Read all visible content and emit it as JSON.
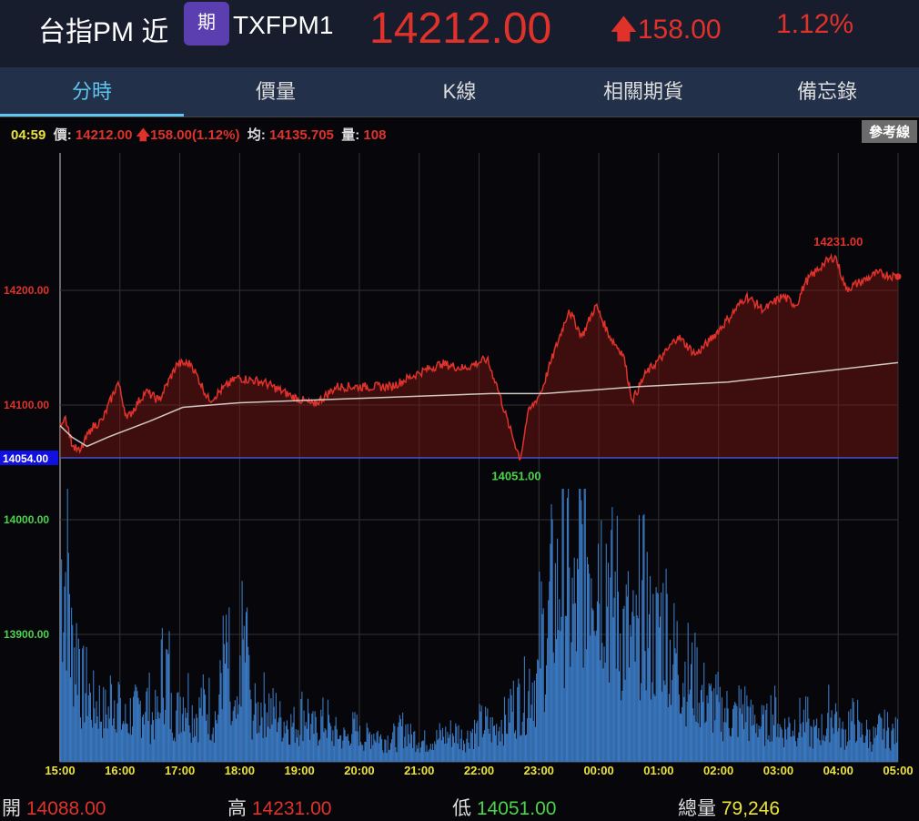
{
  "header": {
    "name": "台指PM 近",
    "badge": "期",
    "code": "TXFPM1",
    "price": "14212.00",
    "change": "158.00",
    "change_pct": "1.12%"
  },
  "tabs": [
    "分時",
    "價量",
    "K線",
    "相關期貨",
    "備忘錄"
  ],
  "info": {
    "time": "04:59",
    "price_label": "價:",
    "price": "14212.00",
    "change": "158.00(1.12%)",
    "avg_label": "均:",
    "avg": "14135.705",
    "vol_label": "量:",
    "vol": "108"
  },
  "ref_button": "參考線",
  "footer": {
    "open_label": "開",
    "open": "14088.00",
    "high_label": "高",
    "high": "14231.00",
    "low_label": "低",
    "low": "14051.00",
    "vol_label": "總量",
    "vol": "79,246"
  },
  "chart_data": {
    "type": "line",
    "y_ticks": [
      {
        "v": 14200,
        "label": "14200.00",
        "color": "#e0322b"
      },
      {
        "v": 14100,
        "label": "14100.00",
        "color": "#e0322b"
      },
      {
        "v": 14000,
        "label": "14000.00",
        "color": "#4cd34c"
      },
      {
        "v": 13900,
        "label": "13900.00",
        "color": "#4cd34c"
      }
    ],
    "ref_price": 14054,
    "ref_label": "14054.00",
    "high": {
      "v": 14231,
      "label": "14231.00",
      "t": 13.0
    },
    "low": {
      "v": 14051,
      "label": "14051.00",
      "t": 7.7
    },
    "x_ticks": [
      "15:00",
      "16:00",
      "17:00",
      "18:00",
      "19:00",
      "20:00",
      "21:00",
      "22:00",
      "23:00",
      "00:00",
      "01:00",
      "02:00",
      "03:00",
      "04:00",
      "05:00"
    ],
    "price_series_hours": [
      [
        0,
        14084
      ],
      [
        0.09,
        14090
      ],
      [
        0.21,
        14064
      ],
      [
        0.33,
        14059
      ],
      [
        0.52,
        14080
      ],
      [
        0.71,
        14087
      ],
      [
        0.97,
        14120
      ],
      [
        1.12,
        14088
      ],
      [
        1.43,
        14112
      ],
      [
        1.65,
        14104
      ],
      [
        1.96,
        14136
      ],
      [
        2.19,
        14136
      ],
      [
        2.49,
        14104
      ],
      [
        2.95,
        14124
      ],
      [
        3.4,
        14120
      ],
      [
        3.86,
        14108
      ],
      [
        4.24,
        14100
      ],
      [
        4.62,
        14116
      ],
      [
        5.08,
        14116
      ],
      [
        5.53,
        14116
      ],
      [
        5.99,
        14128
      ],
      [
        6.37,
        14136
      ],
      [
        6.75,
        14132
      ],
      [
        7.13,
        14140
      ],
      [
        7.28,
        14120
      ],
      [
        7.51,
        14080
      ],
      [
        7.69,
        14053
      ],
      [
        7.81,
        14092
      ],
      [
        8.04,
        14112
      ],
      [
        8.19,
        14136
      ],
      [
        8.5,
        14183
      ],
      [
        8.72,
        14160
      ],
      [
        8.95,
        14187
      ],
      [
        9.18,
        14160
      ],
      [
        9.41,
        14144
      ],
      [
        9.56,
        14104
      ],
      [
        9.79,
        14128
      ],
      [
        10.09,
        14144
      ],
      [
        10.32,
        14160
      ],
      [
        10.62,
        14144
      ],
      [
        10.85,
        14156
      ],
      [
        11.16,
        14175
      ],
      [
        11.46,
        14195
      ],
      [
        11.76,
        14183
      ],
      [
        12.07,
        14195
      ],
      [
        12.3,
        14187
      ],
      [
        12.45,
        14207
      ],
      [
        12.75,
        14223
      ],
      [
        12.95,
        14230
      ],
      [
        13.13,
        14201
      ],
      [
        13.36,
        14207
      ],
      [
        13.66,
        14215
      ],
      [
        14,
        14212
      ]
    ],
    "avg_series_hours": [
      [
        0,
        14082
      ],
      [
        0.2,
        14072
      ],
      [
        0.45,
        14064
      ],
      [
        0.8,
        14072
      ],
      [
        1.5,
        14086
      ],
      [
        2.05,
        14098
      ],
      [
        3,
        14102
      ],
      [
        5.07,
        14106
      ],
      [
        7.2,
        14110
      ],
      [
        8.1,
        14110
      ],
      [
        9.64,
        14116
      ],
      [
        11.16,
        14120
      ],
      [
        12.5,
        14128
      ],
      [
        14,
        14137
      ]
    ],
    "volume_per_10min": [
      230,
      140,
      90,
      70,
      60,
      80,
      50,
      60,
      70,
      55,
      110,
      60,
      80,
      60,
      70,
      55,
      120,
      50,
      140,
      60,
      70,
      60,
      50,
      45,
      60,
      40,
      50,
      35,
      30,
      40,
      30,
      35,
      28,
      30,
      40,
      30,
      25,
      28,
      32,
      35,
      30,
      38,
      45,
      40,
      50,
      70,
      80,
      100,
      150,
      200,
      230,
      180,
      260,
      270,
      240,
      200,
      160,
      140,
      190,
      150,
      170,
      130,
      110,
      100,
      80,
      70,
      60,
      55,
      65,
      50,
      45,
      60,
      40,
      45,
      50,
      35,
      40,
      60,
      35,
      50,
      35,
      30,
      40,
      35
    ]
  }
}
